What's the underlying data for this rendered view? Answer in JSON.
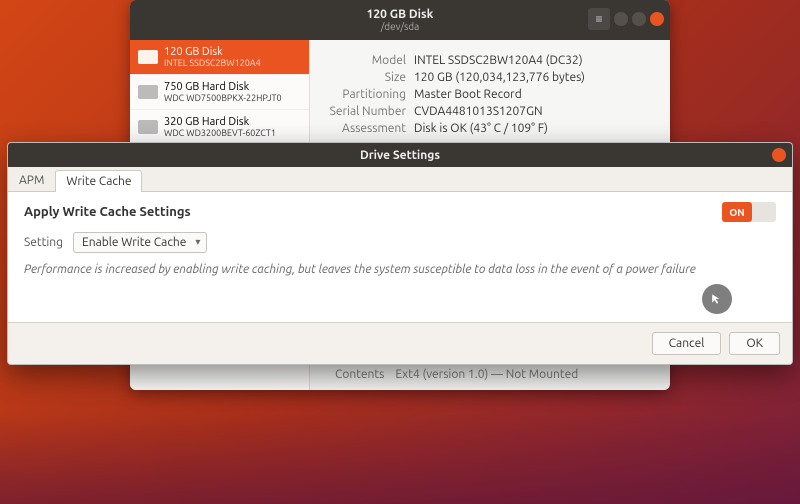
{
  "disks_window": {
    "title": "120 GB Disk",
    "subtitle": "/dev/sda",
    "devices": [
      {
        "name": "120 GB Disk",
        "sub": "INTEL SSDSC2BW120A4",
        "selected": true
      },
      {
        "name": "750 GB Hard Disk",
        "sub": "WDC WD7500BPKX-22HPJT0",
        "selected": false
      },
      {
        "name": "320 GB Hard Disk",
        "sub": "WDC WD3200BEVT-60ZCT1",
        "selected": false
      }
    ],
    "details": {
      "model_label": "Model",
      "model": "INTEL SSDSC2BW120A4 (DC32)",
      "size_label": "Size",
      "size": "120 GB (120,034,123,776 bytes)",
      "part_label": "Partitioning",
      "part": "Master Boot Record",
      "serial_label": "Serial Number",
      "serial": "CVDA4481013S1207GN",
      "assess_label": "Assessment",
      "assess": "Disk is OK (43° C / 109° F)"
    },
    "contents_label": "Contents",
    "contents_value": "Ext4 (version 1.0) — Not Mounted"
  },
  "dialog": {
    "title": "Drive Settings",
    "tabs": {
      "apm": "APM",
      "write_cache": "Write Cache"
    },
    "active_tab": "write_cache",
    "heading": "Apply Write Cache Settings",
    "toggle_on_label": "ON",
    "toggle_state": true,
    "setting_label": "Setting",
    "setting_value": "Enable Write Cache",
    "description": "Performance is increased by enabling write caching, but leaves the system susceptible to data loss in the event of a power failure",
    "buttons": {
      "cancel": "Cancel",
      "ok": "OK"
    }
  }
}
